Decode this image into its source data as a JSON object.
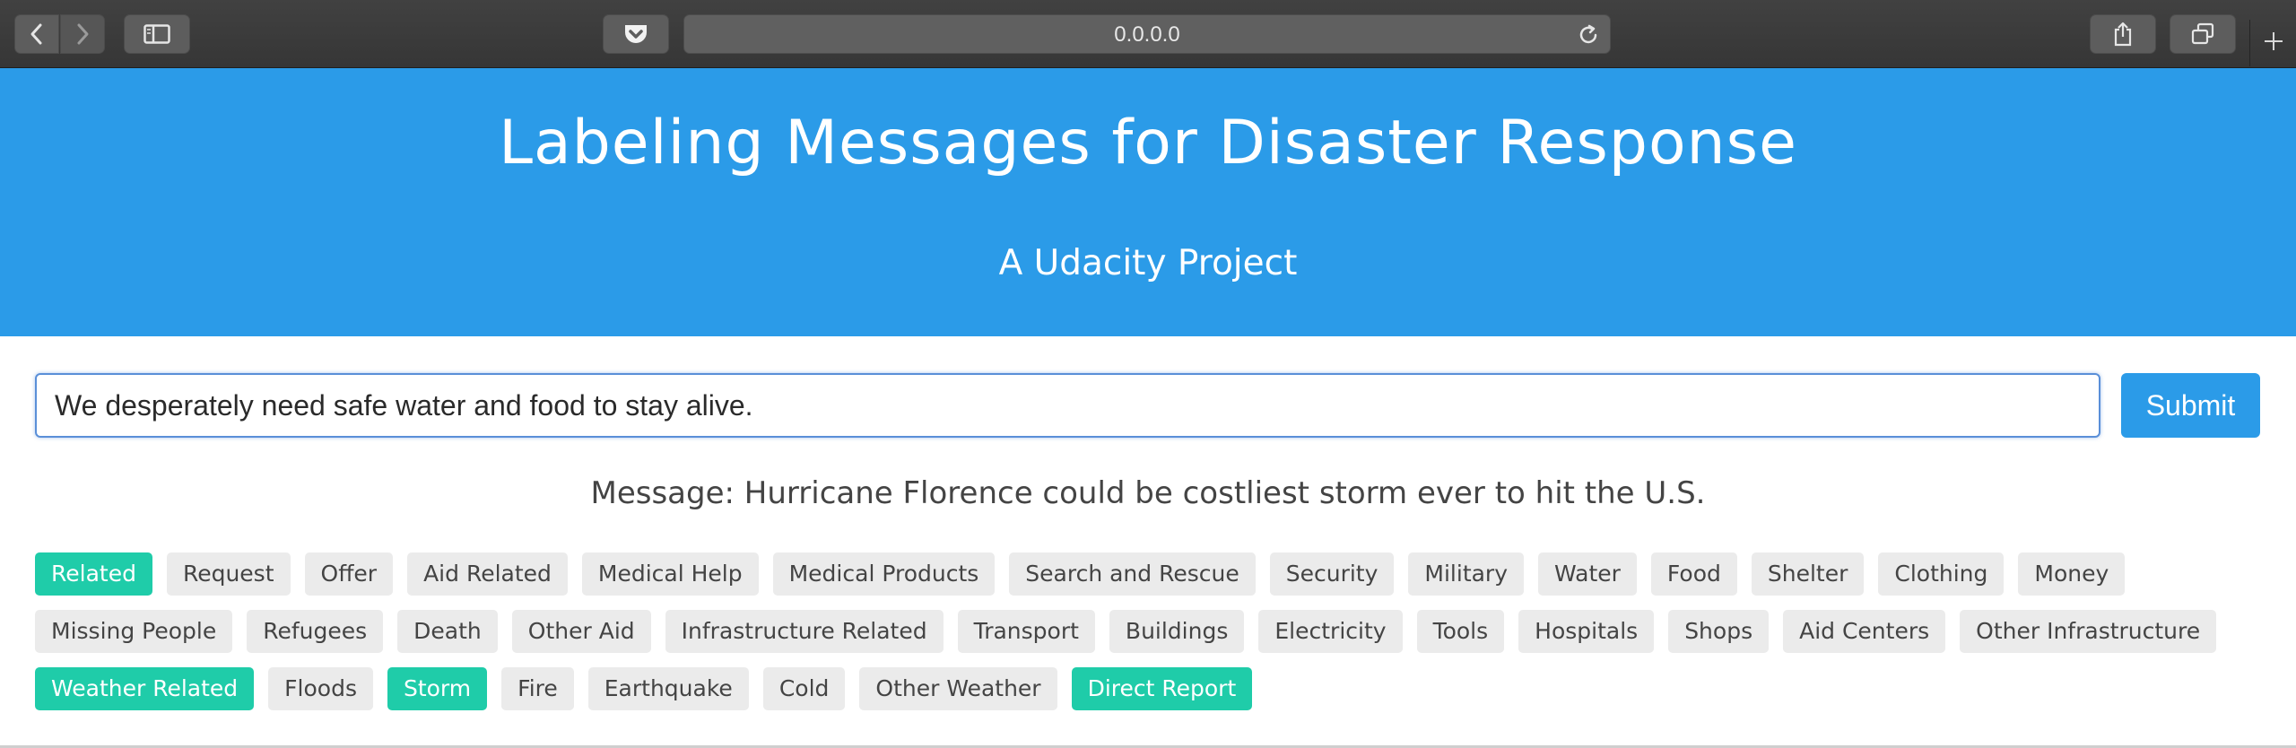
{
  "browser": {
    "url": "0.0.0.0",
    "icons": [
      "chevron-left-icon",
      "chevron-right-icon",
      "sidebar-icon",
      "pocket-icon",
      "reload-icon",
      "share-icon",
      "tabs-icon",
      "plus-icon"
    ]
  },
  "header": {
    "title": "Labeling Messages for Disaster Response",
    "subtitle": "A Udacity Project",
    "background": "#2b9be8"
  },
  "form": {
    "input_value": "We desperately need safe water and food to stay alive.",
    "submit_label": "Submit"
  },
  "result": {
    "message": "Message: Hurricane Florence could be costliest storm ever to hit the U.S."
  },
  "colors": {
    "active_chip": "#1fcca9",
    "inactive_chip": "#ebebeb"
  },
  "categories": [
    {
      "label": "Related",
      "active": true
    },
    {
      "label": "Request",
      "active": false
    },
    {
      "label": "Offer",
      "active": false
    },
    {
      "label": "Aid Related",
      "active": false
    },
    {
      "label": "Medical Help",
      "active": false
    },
    {
      "label": "Medical Products",
      "active": false
    },
    {
      "label": "Search and Rescue",
      "active": false
    },
    {
      "label": "Security",
      "active": false
    },
    {
      "label": "Military",
      "active": false
    },
    {
      "label": "Water",
      "active": false
    },
    {
      "label": "Food",
      "active": false
    },
    {
      "label": "Shelter",
      "active": false
    },
    {
      "label": "Clothing",
      "active": false
    },
    {
      "label": "Money",
      "active": false
    },
    {
      "label": "Missing People",
      "active": false
    },
    {
      "label": "Refugees",
      "active": false
    },
    {
      "label": "Death",
      "active": false
    },
    {
      "label": "Other Aid",
      "active": false
    },
    {
      "label": "Infrastructure Related",
      "active": false
    },
    {
      "label": "Transport",
      "active": false
    },
    {
      "label": "Buildings",
      "active": false
    },
    {
      "label": "Electricity",
      "active": false
    },
    {
      "label": "Tools",
      "active": false
    },
    {
      "label": "Hospitals",
      "active": false
    },
    {
      "label": "Shops",
      "active": false
    },
    {
      "label": "Aid Centers",
      "active": false
    },
    {
      "label": "Other Infrastructure",
      "active": false
    },
    {
      "label": "Weather Related",
      "active": true
    },
    {
      "label": "Floods",
      "active": false
    },
    {
      "label": "Storm",
      "active": true
    },
    {
      "label": "Fire",
      "active": false
    },
    {
      "label": "Earthquake",
      "active": false
    },
    {
      "label": "Cold",
      "active": false
    },
    {
      "label": "Other Weather",
      "active": false
    },
    {
      "label": "Direct Report",
      "active": true
    }
  ]
}
